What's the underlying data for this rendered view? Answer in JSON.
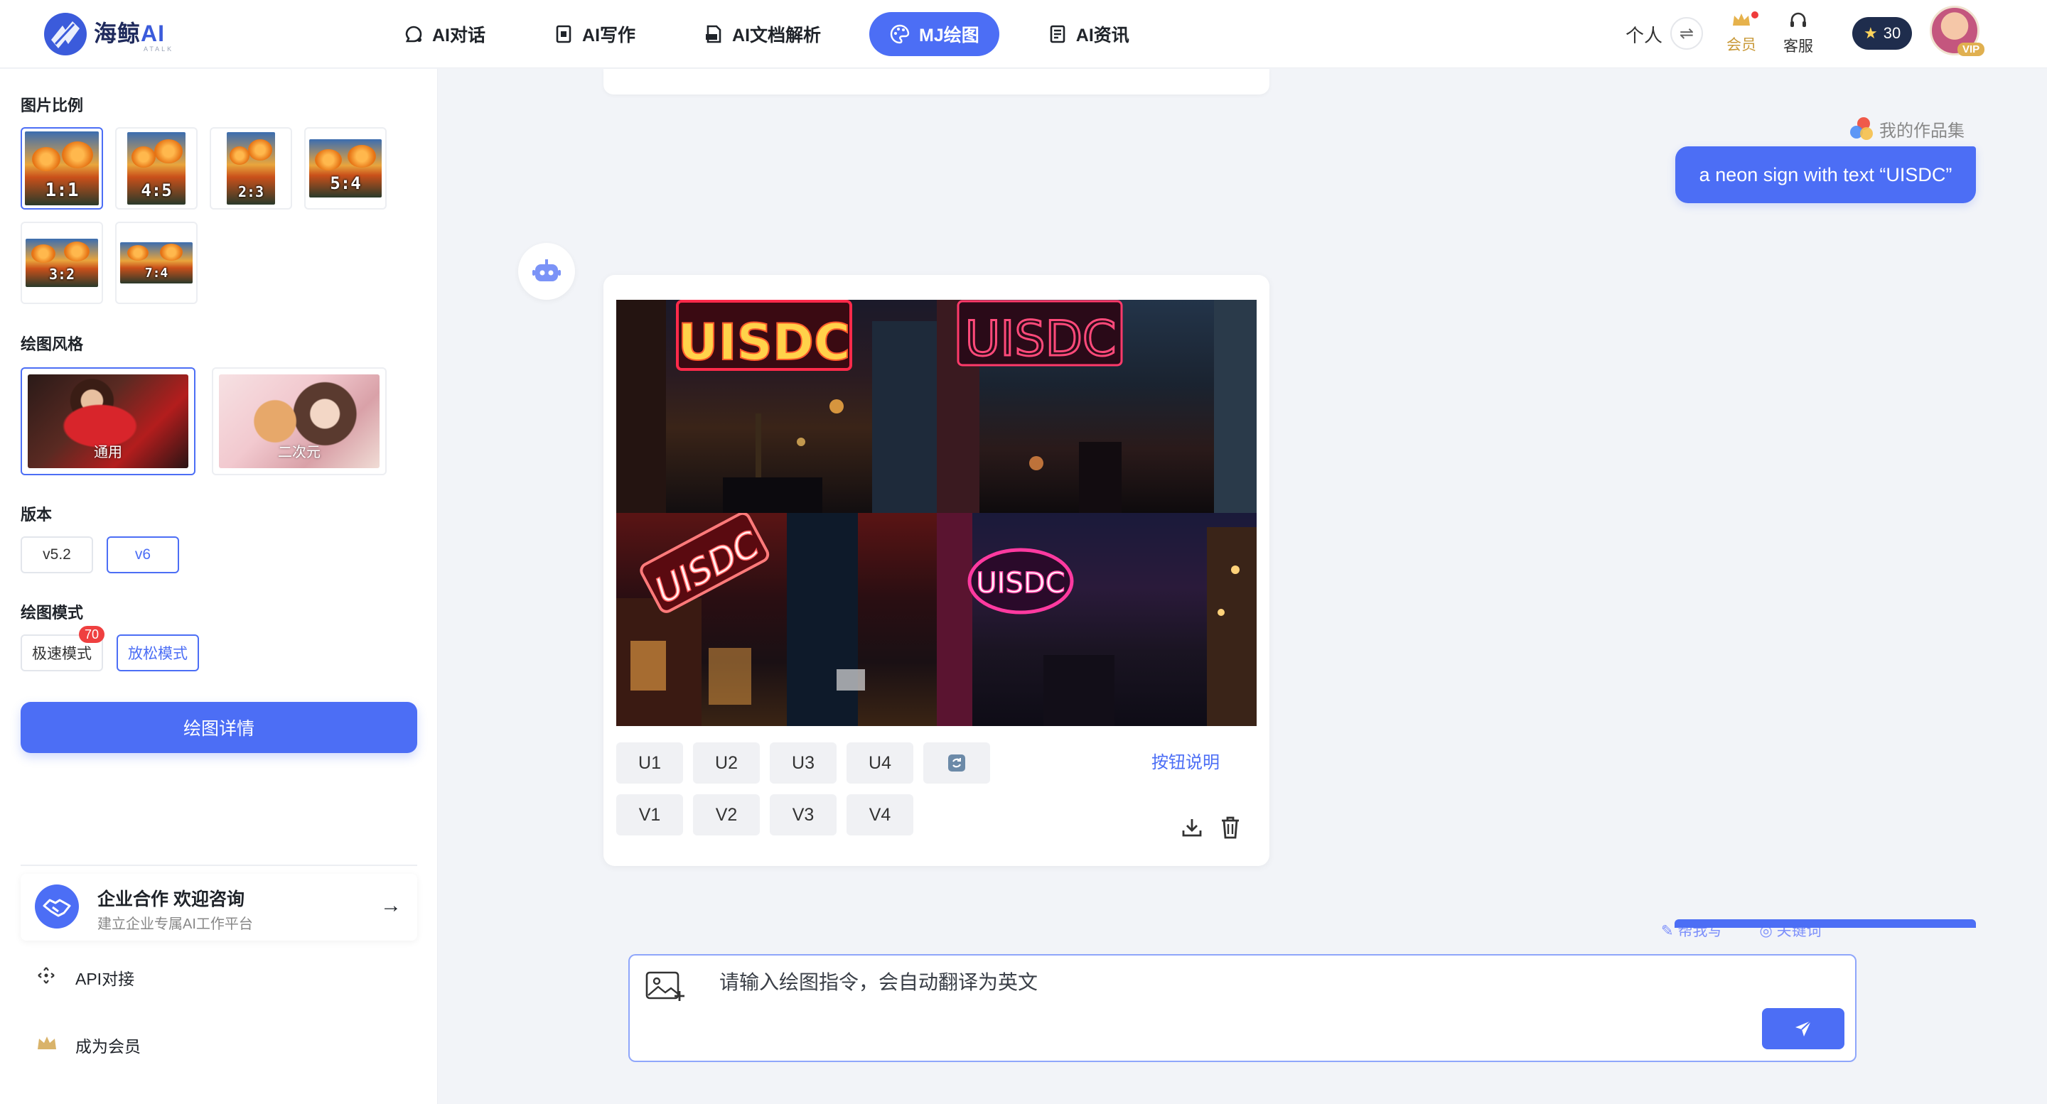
{
  "header": {
    "logo_title": "海鲸",
    "logo_title_suffix": "AI",
    "logo_sub": "ATALK",
    "nav": [
      {
        "label": "AI对话",
        "icon": "chat-icon"
      },
      {
        "label": "AI写作",
        "icon": "edit-doc-icon"
      },
      {
        "label": "AI文档解析",
        "icon": "pdf-icon"
      },
      {
        "label": "MJ绘图",
        "icon": "palette-icon",
        "active": true
      },
      {
        "label": "AI资讯",
        "icon": "news-icon"
      }
    ],
    "personal_label": "个人",
    "member_label": "会员",
    "service_label": "客服",
    "points": "30",
    "vip_badge": "VIP"
  },
  "sidebar": {
    "ratio_title": "图片比例",
    "ratios": [
      "1:1",
      "4:5",
      "2:3",
      "5:4",
      "3:2",
      "7:4"
    ],
    "selected_ratio": "1:1",
    "style_title": "绘图风格",
    "styles": [
      "通用",
      "二次元"
    ],
    "selected_style": "通用",
    "version_title": "版本",
    "versions": [
      "v5.2",
      "v6"
    ],
    "selected_version": "v6",
    "mode_title": "绘图模式",
    "modes": [
      "极速模式",
      "放松模式"
    ],
    "mode_badge": "70",
    "selected_mode": "放松模式",
    "detail_button": "绘图详情",
    "enterprise_title": "企业合作 欢迎咨询",
    "enterprise_sub": "建立企业专属AI工作平台",
    "api_link": "API对接",
    "member_link": "成为会员"
  },
  "chat": {
    "portfolio_label": "我的作品集",
    "user_prompt": "a neon sign with text “UISDC”",
    "image_text": [
      "UISDC",
      "UISDC",
      "UISDC",
      "UISDC"
    ],
    "upscale_buttons": [
      "U1",
      "U2",
      "U3",
      "U4"
    ],
    "variation_buttons": [
      "V1",
      "V2",
      "V3",
      "V4"
    ],
    "help_link": "按钮说明"
  },
  "input": {
    "hint_tags": [
      "帮我写",
      "关键词"
    ],
    "placeholder": "请输入绘图指令，会自动翻译为英文"
  },
  "colors": {
    "accent": "#4c6ef5",
    "background": "#f2f4f8",
    "badge_red": "#ef4040",
    "gold": "#c99a3a"
  }
}
